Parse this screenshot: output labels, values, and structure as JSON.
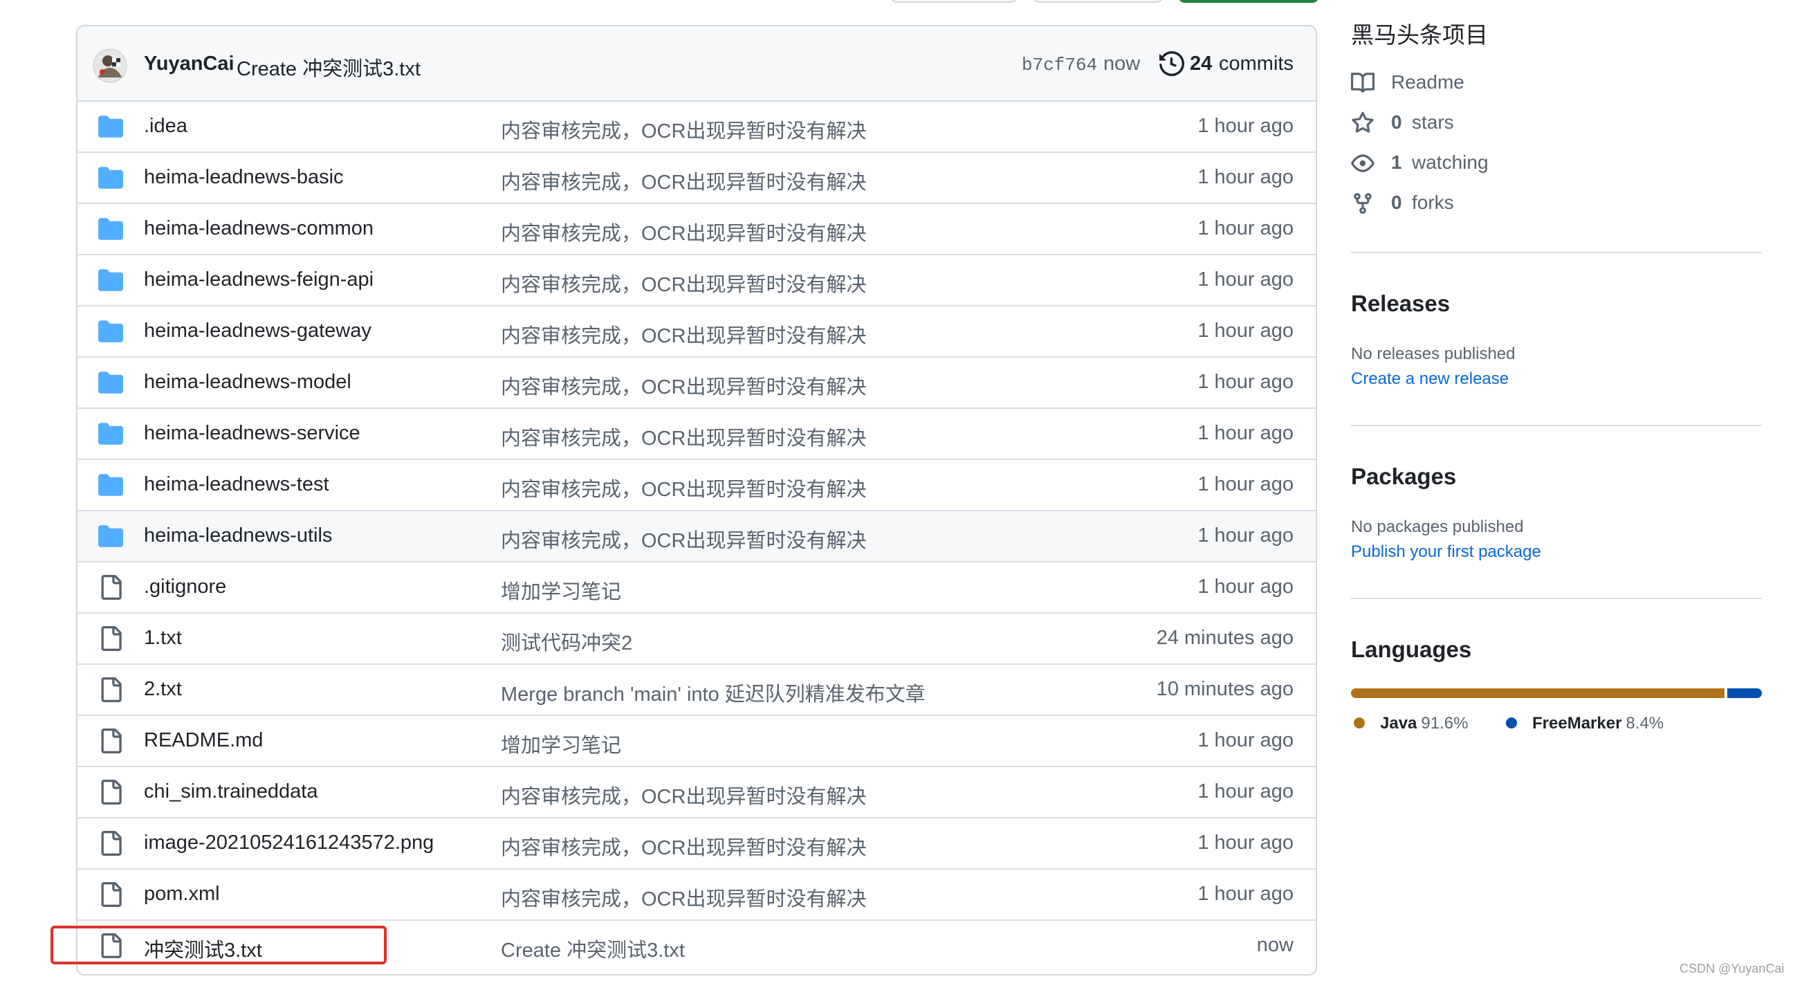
{
  "commit": {
    "author": "YuyanCai",
    "message": "Create 冲突测试3.txt",
    "sha": "b7cf764",
    "time": "now",
    "count": "24",
    "count_label": "commits"
  },
  "files": [
    {
      "name": ".idea",
      "type": "folder",
      "message": "内容审核完成，OCR出现异暂时没有解决",
      "time": "1 hour ago"
    },
    {
      "name": "heima-leadnews-basic",
      "type": "folder",
      "message": "内容审核完成，OCR出现异暂时没有解决",
      "time": "1 hour ago"
    },
    {
      "name": "heima-leadnews-common",
      "type": "folder",
      "message": "内容审核完成，OCR出现异暂时没有解决",
      "time": "1 hour ago"
    },
    {
      "name": "heima-leadnews-feign-api",
      "type": "folder",
      "message": "内容审核完成，OCR出现异暂时没有解决",
      "time": "1 hour ago"
    },
    {
      "name": "heima-leadnews-gateway",
      "type": "folder",
      "message": "内容审核完成，OCR出现异暂时没有解决",
      "time": "1 hour ago"
    },
    {
      "name": "heima-leadnews-model",
      "type": "folder",
      "message": "内容审核完成，OCR出现异暂时没有解决",
      "time": "1 hour ago"
    },
    {
      "name": "heima-leadnews-service",
      "type": "folder",
      "message": "内容审核完成，OCR出现异暂时没有解决",
      "time": "1 hour ago"
    },
    {
      "name": "heima-leadnews-test",
      "type": "folder",
      "message": "内容审核完成，OCR出现异暂时没有解决",
      "time": "1 hour ago"
    },
    {
      "name": "heima-leadnews-utils",
      "type": "folder",
      "message": "内容审核完成，OCR出现异暂时没有解决",
      "time": "1 hour ago"
    },
    {
      "name": ".gitignore",
      "type": "file",
      "message": "增加学习笔记",
      "time": "1 hour ago"
    },
    {
      "name": "1.txt",
      "type": "file",
      "message": "测试代码冲突2",
      "time": "24 minutes ago"
    },
    {
      "name": "2.txt",
      "type": "file",
      "message": "Merge branch 'main' into 延迟队列精准发布文章",
      "time": "10 minutes ago"
    },
    {
      "name": "README.md",
      "type": "file",
      "message": "增加学习笔记",
      "time": "1 hour ago"
    },
    {
      "name": "chi_sim.traineddata",
      "type": "file",
      "message": "内容审核完成，OCR出现异暂时没有解决",
      "time": "1 hour ago"
    },
    {
      "name": "image-20210524161243572.png",
      "type": "file",
      "message": "内容审核完成，OCR出现异暂时没有解决",
      "time": "1 hour ago"
    },
    {
      "name": "pom.xml",
      "type": "file",
      "message": "内容审核完成，OCR出现异暂时没有解决",
      "time": "1 hour ago"
    },
    {
      "name": "冲突测试3.txt",
      "type": "file",
      "message": "Create 冲突测试3.txt",
      "time": "now"
    }
  ],
  "about": {
    "description": "黑马头条项目",
    "readme": "Readme",
    "stars_num": "0",
    "stars_label": "stars",
    "watching_num": "1",
    "watching_label": "watching",
    "forks_num": "0",
    "forks_label": "forks"
  },
  "releases": {
    "title": "Releases",
    "empty": "No releases published",
    "link": "Create a new release"
  },
  "packages": {
    "title": "Packages",
    "empty": "No packages published",
    "link": "Publish your first package"
  },
  "languages": {
    "title": "Languages",
    "items": [
      {
        "name": "Java",
        "percent": "91.6%",
        "value": 91.6,
        "color": "#b07219"
      },
      {
        "name": "FreeMarker",
        "percent": "8.4%",
        "value": 8.4,
        "color": "#0050b2"
      }
    ]
  },
  "colors": {
    "link": "#0969da",
    "highlight_box": "#e0302a",
    "folder_icon": "#54aeff"
  },
  "watermark": "CSDN @YuyanCai"
}
